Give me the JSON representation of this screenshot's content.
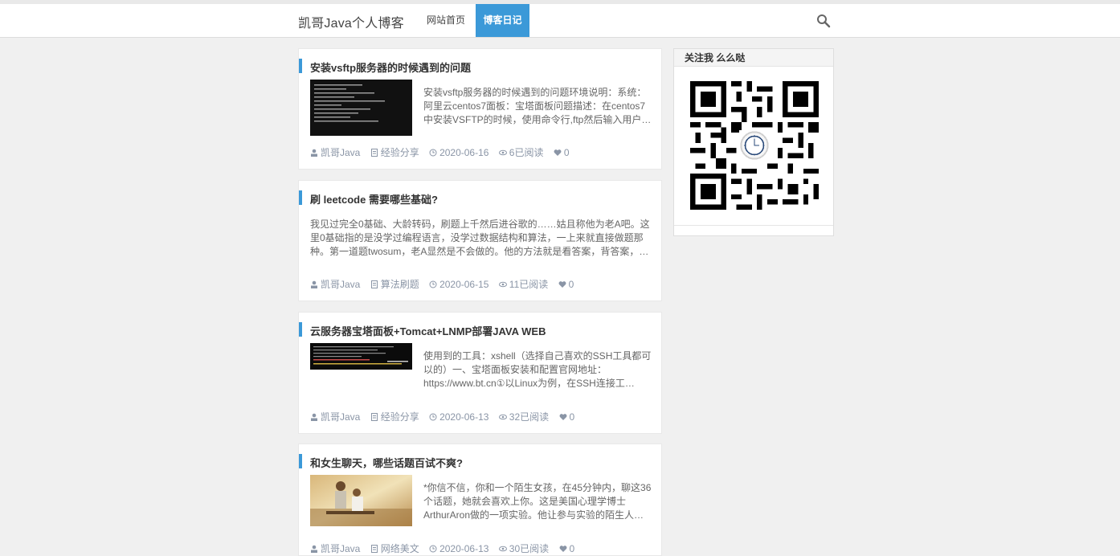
{
  "header": {
    "site_title": "凯哥Java个人博客",
    "nav": [
      {
        "label": "网站首页",
        "active": false
      },
      {
        "label": "博客日记",
        "active": true
      }
    ],
    "search_icon": "search-icon",
    "accent_color": "#3b99d8"
  },
  "posts": [
    {
      "title": "安装vsftp服务器的时候遇到的问题",
      "excerpt": "安装vsftp服务器的时候遇到的问题环境说明：系统：阿里云centos7面板：宝塔面板问题描述：在centos7中安装VSFTP的时候，使用命令行,ftp然后输入用户…",
      "author": "凯哥Java",
      "category": "经验分享",
      "date": "2020-06-16",
      "views": "6已阅读",
      "likes": "0"
    },
    {
      "title": "刷 leetcode 需要哪些基础?",
      "excerpt": "我见过完全0基础、大龄转码，刷题上千然后进谷歌的……姑且称他为老A吧。这里0基础指的是没学过编程语言，没学过数据结构和算法，一上来就直接做题那种。第一道题twosum，老A显然是不会做的。他的方法就是看答案，背答案，…",
      "author": "凯哥Java",
      "category": "算法刷题",
      "date": "2020-06-15",
      "views": "11已阅读",
      "likes": "0"
    },
    {
      "title": "云服务器宝塔面板+Tomcat+LNMP部署JAVA WEB",
      "excerpt": "使用到的工具：xshell（选择自己喜欢的SSH工具都可以的）一、宝塔面板安装和配置官网地址：https://www.bt.cn①以Linux为例，在SSH连接工…",
      "author": "凯哥Java",
      "category": "经验分享",
      "date": "2020-06-13",
      "views": "32已阅读",
      "likes": "0"
    },
    {
      "title": "和女生聊天，哪些话题百试不爽?",
      "excerpt": "*你信不信，你和一个陌生女孩，在45分钟内，聊这36个话题，她就会喜欢上你。这是美国心理学博士ArthurAron做的一项实验。他让参与实验的陌生人…",
      "author": "凯哥Java",
      "category": "网络美文",
      "date": "2020-06-13",
      "views": "30已阅读",
      "likes": "0"
    }
  ],
  "sidebar": {
    "widget_title": "关注我 么么哒",
    "qr_icon": "qr-code"
  }
}
